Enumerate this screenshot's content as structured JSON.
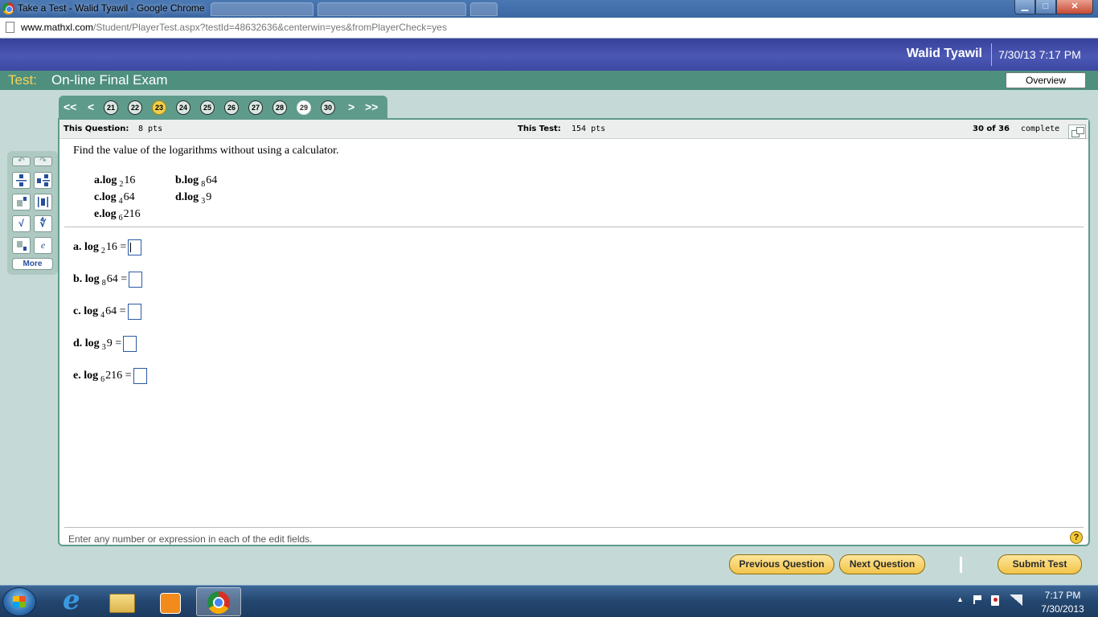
{
  "browser": {
    "window_title": "Take a Test - Walid Tyawil - Google Chrome",
    "url_domain": "www.mathxl.com",
    "url_path": "/Student/PlayerTest.aspx?testId=48632636&centerwin=yes&fromPlayerCheck=yes",
    "minimize_label": "▁",
    "maximize_label": "□",
    "close_label": "✕"
  },
  "header": {
    "user_name": "Walid Tyawil",
    "datetime": "7/30/13 7:17 PM"
  },
  "test": {
    "label": "Test:",
    "name": "On-line Final Exam",
    "overview_label": "Overview"
  },
  "pager": {
    "first": "<<",
    "prev": "<",
    "next": ">",
    "last": ">>",
    "current": "23",
    "numbers": [
      "21",
      "22",
      "23",
      "24",
      "25",
      "26",
      "27",
      "28",
      "29",
      "30"
    ]
  },
  "info": {
    "this_question_label": "This Question:",
    "this_question_pts": "8 pts",
    "this_test_label": "This Test:",
    "this_test_pts": "154 pts",
    "progress": "30 of 36",
    "progress_suffix": "complete"
  },
  "question": {
    "instructions": "Find the value of the logarithms without using a calculator.",
    "problems": [
      {
        "letter": "a.",
        "log": "log",
        "base": "2",
        "arg": "16"
      },
      {
        "letter": "b.",
        "log": "log",
        "base": "8",
        "arg": "64"
      },
      {
        "letter": "c.",
        "log": "log",
        "base": "4",
        "arg": "64"
      },
      {
        "letter": "d.",
        "log": "log",
        "base": "3",
        "arg": "9"
      },
      {
        "letter": "e.",
        "log": "log",
        "base": "6",
        "arg": "216"
      }
    ],
    "answers": [
      {
        "label": "a. log",
        "base": "2",
        "arg": "16 =",
        "value": ""
      },
      {
        "label": "b. log",
        "base": "8",
        "arg": "64 =",
        "value": ""
      },
      {
        "label": "c. log",
        "base": "4",
        "arg": "64 =",
        "value": ""
      },
      {
        "label": "d. log",
        "base": "3",
        "arg": "9 =",
        "value": ""
      },
      {
        "label": "e. log",
        "base": "6",
        "arg": "216 =",
        "value": ""
      }
    ],
    "hint": "Enter any number or expression in each of the edit fields.",
    "help": "?"
  },
  "palette": {
    "undo": "↶",
    "redo": "↷",
    "sqrt": "√",
    "nthroot": "∜",
    "e": "e",
    "more_label": "More"
  },
  "buttons": {
    "previous": "Previous Question",
    "next": "Next Question",
    "submit": "Submit Test"
  },
  "taskbar": {
    "tray_arrow": "▲",
    "time": "7:17 PM",
    "date": "7/30/2013"
  }
}
